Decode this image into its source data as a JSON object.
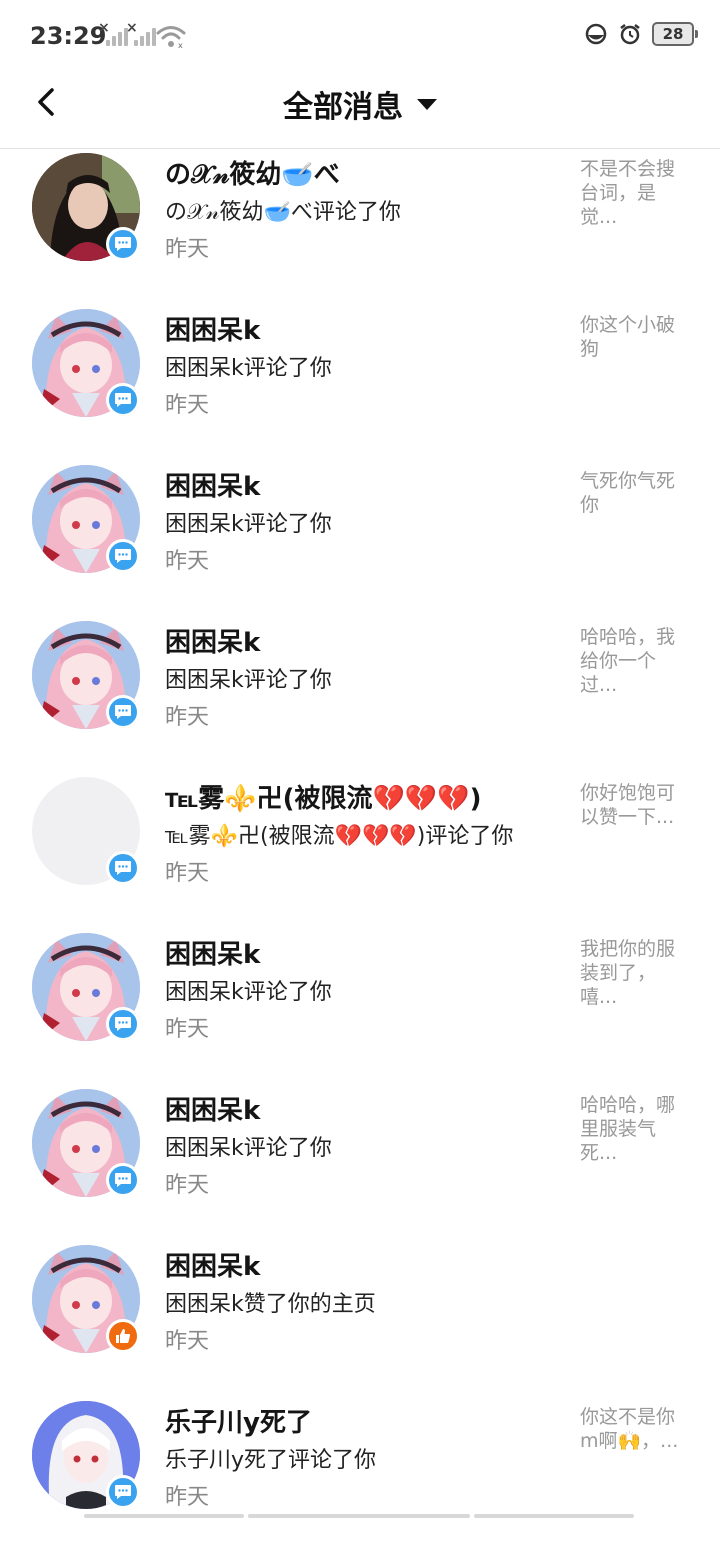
{
  "status_bar": {
    "time": "23:29",
    "battery": "28",
    "icons": [
      "signal-1-icon",
      "signal-2-icon",
      "wifi-icon",
      "do-not-disturb-icon",
      "alarm-icon",
      "battery-icon"
    ]
  },
  "header": {
    "back_icon": "chevron-left-icon",
    "title": "全部消息",
    "dropdown_icon": "caret-down-icon"
  },
  "notifications": [
    {
      "name": "の𝒳𝓃筱幼🥣べ",
      "action": "の𝒳𝓃筱幼🥣べ评论了你",
      "time": "昨天",
      "preview": "不是不会搜台词，是觉...",
      "badge": "comment",
      "avatar": "photo"
    },
    {
      "name": "困困呆k",
      "action": "困困呆k评论了你",
      "time": "昨天",
      "preview": "你这个小破狗",
      "badge": "comment",
      "avatar": "anime-pink"
    },
    {
      "name": "困困呆k",
      "action": "困困呆k评论了你",
      "time": "昨天",
      "preview": "气死你气死你",
      "badge": "comment",
      "avatar": "anime-pink"
    },
    {
      "name": "困困呆k",
      "action": "困困呆k评论了你",
      "time": "昨天",
      "preview": "哈哈哈，我给你一个过...",
      "badge": "comment",
      "avatar": "anime-pink"
    },
    {
      "name": "℡雾⚜️卍(被限流💔💔💔)",
      "action": "℡雾⚜️卍(被限流💔💔💔)评论了你",
      "time": "昨天",
      "preview": "你好饱饱可以赞一下...",
      "badge": "comment",
      "avatar": "blank"
    },
    {
      "name": "困困呆k",
      "action": "困困呆k评论了你",
      "time": "昨天",
      "preview": "我把你的服装到了，嘻...",
      "badge": "comment",
      "avatar": "anime-pink"
    },
    {
      "name": "困困呆k",
      "action": "困困呆k评论了你",
      "time": "昨天",
      "preview": "哈哈哈，哪里服装气死...",
      "badge": "comment",
      "avatar": "anime-pink"
    },
    {
      "name": "困困呆k",
      "action": "困困呆k赞了你的主页",
      "time": "昨天",
      "preview": "",
      "badge": "like",
      "avatar": "anime-pink"
    },
    {
      "name": "乐子川y死了",
      "action": "乐子川y死了评论了你",
      "time": "昨天",
      "preview": "你这不是你m啊🙌，...",
      "badge": "comment",
      "avatar": "anime-white"
    }
  ],
  "colors": {
    "comment_badge": "#3aa3f0",
    "like_badge": "#f06a0f",
    "secondary_text": "#888888",
    "preview_text": "#999999",
    "divider": "#e3e3e3"
  }
}
